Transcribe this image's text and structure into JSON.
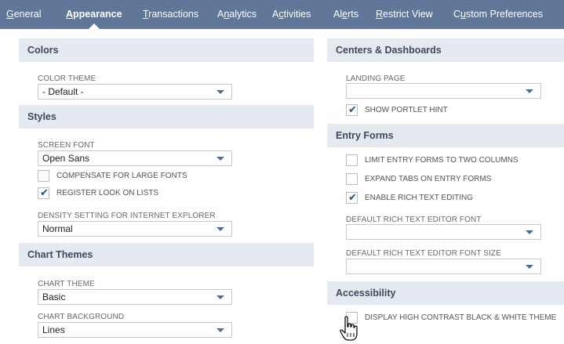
{
  "tabs": [
    {
      "pre": "",
      "u": "G",
      "post": "eneral",
      "active": false
    },
    {
      "pre": "",
      "u": "A",
      "post": "ppearance",
      "active": true
    },
    {
      "pre": "",
      "u": "T",
      "post": "ransactions",
      "active": false
    },
    {
      "pre": "A",
      "u": "n",
      "post": "alytics",
      "active": false
    },
    {
      "pre": "A",
      "u": "c",
      "post": "tivities",
      "active": false
    },
    {
      "pre": "Al",
      "u": "e",
      "post": "rts",
      "active": false
    },
    {
      "pre": "",
      "u": "R",
      "post": "estrict View",
      "active": false
    },
    {
      "pre": "C",
      "u": "u",
      "post": "stom Preferences",
      "active": false
    }
  ],
  "left": {
    "colors": {
      "title": "Colors",
      "color_theme_label": "COLOR THEME",
      "color_theme_value": "- Default -"
    },
    "styles": {
      "title": "Styles",
      "screen_font_label": "SCREEN FONT",
      "screen_font_value": "Open Sans",
      "compensate_label": "COMPENSATE FOR LARGE FONTS",
      "compensate_checked": false,
      "register_look_label": "REGISTER LOOK ON LISTS",
      "register_look_checked": true,
      "density_label": "DENSITY SETTING FOR INTERNET EXPLORER",
      "density_value": "Normal"
    },
    "chart_themes": {
      "title": "Chart Themes",
      "chart_theme_label": "CHART THEME",
      "chart_theme_value": "Basic",
      "chart_background_label": "CHART BACKGROUND",
      "chart_background_value": "Lines"
    }
  },
  "right": {
    "centers": {
      "title": "Centers & Dashboards",
      "landing_page_label": "LANDING PAGE",
      "landing_page_value": "",
      "portlet_hint_label": "SHOW PORTLET HINT",
      "portlet_hint_checked": true
    },
    "entry_forms": {
      "title": "Entry Forms",
      "limit_label": "LIMIT ENTRY FORMS TO TWO COLUMNS",
      "limit_checked": false,
      "expand_label": "EXPAND TABS ON ENTRY FORMS",
      "expand_checked": false,
      "rich_text_label": "ENABLE RICH TEXT EDITING",
      "rich_text_checked": true,
      "rte_font_label": "DEFAULT RICH TEXT EDITOR FONT",
      "rte_font_value": "",
      "rte_font_size_label": "DEFAULT RICH TEXT EDITOR FONT SIZE",
      "rte_font_size_value": ""
    },
    "accessibility": {
      "title": "Accessibility",
      "contrast_label": "DISPLAY HIGH CONTRAST BLACK & WHITE THEME",
      "contrast_checked": false
    }
  },
  "icons": {
    "checkmark": "check-icon",
    "dropdown": "dropdown-arrow-icon",
    "cursor": "hand-pointer-icon"
  }
}
